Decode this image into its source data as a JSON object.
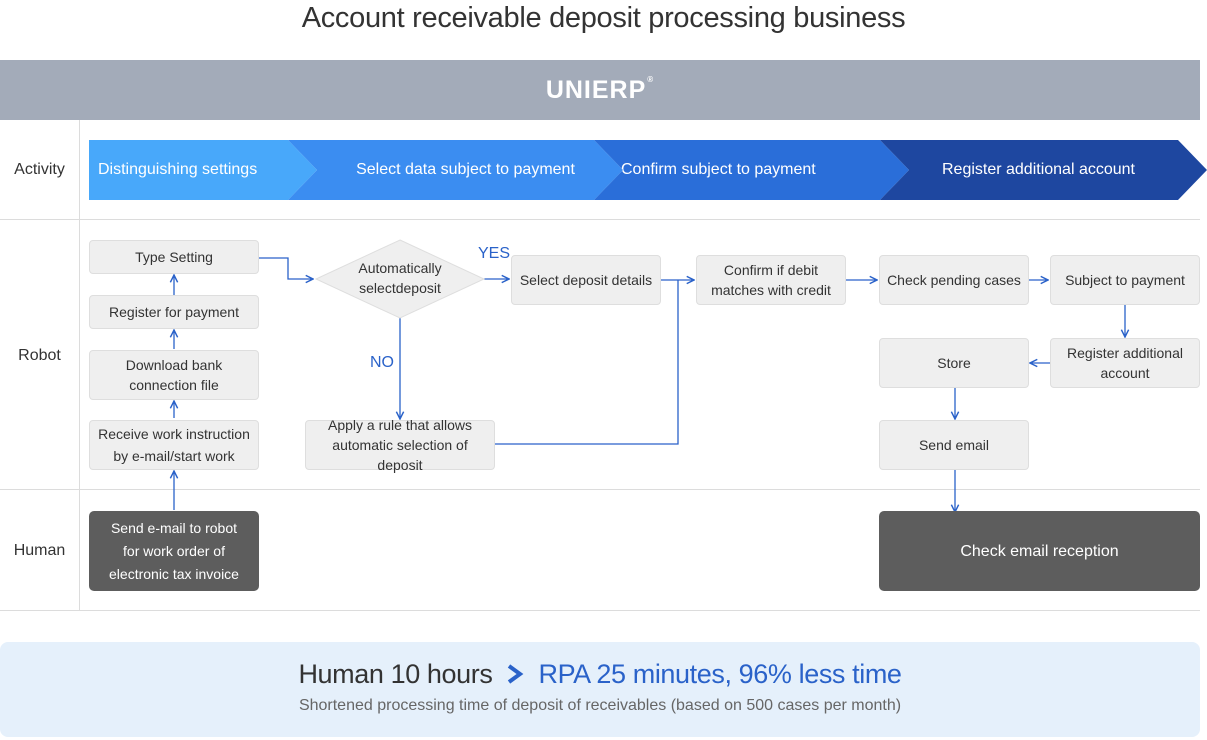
{
  "title": "Account receivable deposit processing business",
  "brand": {
    "name": "UNIERP",
    "mark": "®"
  },
  "lanes": {
    "activity": "Activity",
    "robot": "Robot",
    "human": "Human"
  },
  "activities": [
    {
      "label": "Distinguishing settings",
      "color": "#48a8fa"
    },
    {
      "label": "Select data subject to payment",
      "color": "#3b8df1"
    },
    {
      "label": "Confirm subject to payment",
      "color": "#2a6ed9"
    },
    {
      "label": "Register additional account",
      "color": "#1e47a0"
    }
  ],
  "robot_steps": {
    "type_setting": "Type Setting",
    "register_payment": "Register for payment",
    "download_bank_1": "Download bank",
    "download_bank_2": "connection file",
    "receive_1": "Receive work instruction",
    "receive_2": "by e-mail/start work",
    "auto_select_1": "Automatically",
    "auto_select_2": "selectdeposit",
    "select_details": "Select deposit details",
    "apply_rule_1": "Apply a rule that allows",
    "apply_rule_2": "automatic selection of deposit",
    "confirm_debit_1": "Confirm if debit",
    "confirm_debit_2": "matches with credit",
    "check_pending": "Check pending cases",
    "subject_payment": "Subject to payment",
    "register_account_1": "Register additional",
    "register_account_2": "account",
    "store": "Store",
    "send_email": "Send email"
  },
  "branch": {
    "yes": "YES",
    "no": "NO"
  },
  "human_steps": {
    "send_email_1": "Send e-mail to robot",
    "send_email_2": "for work order of",
    "send_email_3": "electronic tax invoice",
    "check_reception": "Check email reception"
  },
  "summary": {
    "human": "Human 10 hours",
    "rpa": "RPA 25 minutes, 96% less time",
    "note": "Shortened processing time of deposit of receivables (based on 500 cases per month)"
  },
  "colors": {
    "arrow": "#2a62c9",
    "box_bg": "#efefef",
    "dark_box": "#5d5d5d",
    "brand_band": "#a3abb9",
    "summary_bg": "#e5f0fb"
  }
}
